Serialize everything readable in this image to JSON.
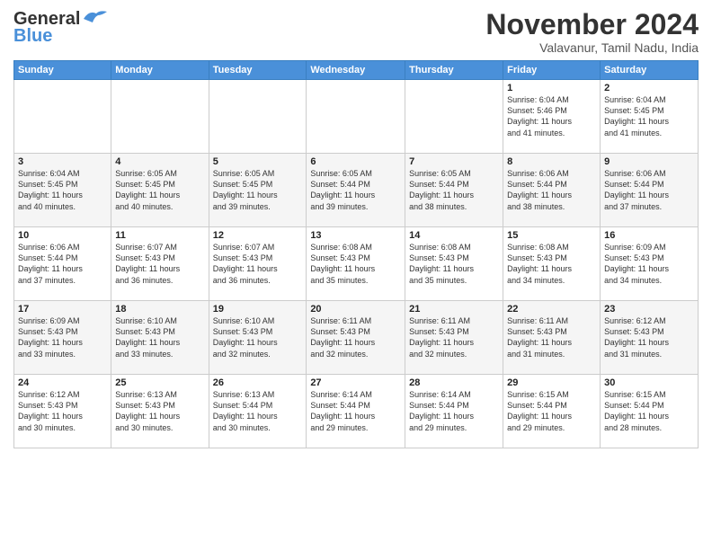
{
  "logo": {
    "general": "General",
    "blue": "Blue"
  },
  "header": {
    "month": "November 2024",
    "location": "Valavanur, Tamil Nadu, India"
  },
  "weekdays": [
    "Sunday",
    "Monday",
    "Tuesday",
    "Wednesday",
    "Thursday",
    "Friday",
    "Saturday"
  ],
  "weeks": [
    [
      {
        "day": "",
        "info": ""
      },
      {
        "day": "",
        "info": ""
      },
      {
        "day": "",
        "info": ""
      },
      {
        "day": "",
        "info": ""
      },
      {
        "day": "",
        "info": ""
      },
      {
        "day": "1",
        "info": "Sunrise: 6:04 AM\nSunset: 5:46 PM\nDaylight: 11 hours\nand 41 minutes."
      },
      {
        "day": "2",
        "info": "Sunrise: 6:04 AM\nSunset: 5:45 PM\nDaylight: 11 hours\nand 41 minutes."
      }
    ],
    [
      {
        "day": "3",
        "info": "Sunrise: 6:04 AM\nSunset: 5:45 PM\nDaylight: 11 hours\nand 40 minutes."
      },
      {
        "day": "4",
        "info": "Sunrise: 6:05 AM\nSunset: 5:45 PM\nDaylight: 11 hours\nand 40 minutes."
      },
      {
        "day": "5",
        "info": "Sunrise: 6:05 AM\nSunset: 5:45 PM\nDaylight: 11 hours\nand 39 minutes."
      },
      {
        "day": "6",
        "info": "Sunrise: 6:05 AM\nSunset: 5:44 PM\nDaylight: 11 hours\nand 39 minutes."
      },
      {
        "day": "7",
        "info": "Sunrise: 6:05 AM\nSunset: 5:44 PM\nDaylight: 11 hours\nand 38 minutes."
      },
      {
        "day": "8",
        "info": "Sunrise: 6:06 AM\nSunset: 5:44 PM\nDaylight: 11 hours\nand 38 minutes."
      },
      {
        "day": "9",
        "info": "Sunrise: 6:06 AM\nSunset: 5:44 PM\nDaylight: 11 hours\nand 37 minutes."
      }
    ],
    [
      {
        "day": "10",
        "info": "Sunrise: 6:06 AM\nSunset: 5:44 PM\nDaylight: 11 hours\nand 37 minutes."
      },
      {
        "day": "11",
        "info": "Sunrise: 6:07 AM\nSunset: 5:43 PM\nDaylight: 11 hours\nand 36 minutes."
      },
      {
        "day": "12",
        "info": "Sunrise: 6:07 AM\nSunset: 5:43 PM\nDaylight: 11 hours\nand 36 minutes."
      },
      {
        "day": "13",
        "info": "Sunrise: 6:08 AM\nSunset: 5:43 PM\nDaylight: 11 hours\nand 35 minutes."
      },
      {
        "day": "14",
        "info": "Sunrise: 6:08 AM\nSunset: 5:43 PM\nDaylight: 11 hours\nand 35 minutes."
      },
      {
        "day": "15",
        "info": "Sunrise: 6:08 AM\nSunset: 5:43 PM\nDaylight: 11 hours\nand 34 minutes."
      },
      {
        "day": "16",
        "info": "Sunrise: 6:09 AM\nSunset: 5:43 PM\nDaylight: 11 hours\nand 34 minutes."
      }
    ],
    [
      {
        "day": "17",
        "info": "Sunrise: 6:09 AM\nSunset: 5:43 PM\nDaylight: 11 hours\nand 33 minutes."
      },
      {
        "day": "18",
        "info": "Sunrise: 6:10 AM\nSunset: 5:43 PM\nDaylight: 11 hours\nand 33 minutes."
      },
      {
        "day": "19",
        "info": "Sunrise: 6:10 AM\nSunset: 5:43 PM\nDaylight: 11 hours\nand 32 minutes."
      },
      {
        "day": "20",
        "info": "Sunrise: 6:11 AM\nSunset: 5:43 PM\nDaylight: 11 hours\nand 32 minutes."
      },
      {
        "day": "21",
        "info": "Sunrise: 6:11 AM\nSunset: 5:43 PM\nDaylight: 11 hours\nand 32 minutes."
      },
      {
        "day": "22",
        "info": "Sunrise: 6:11 AM\nSunset: 5:43 PM\nDaylight: 11 hours\nand 31 minutes."
      },
      {
        "day": "23",
        "info": "Sunrise: 6:12 AM\nSunset: 5:43 PM\nDaylight: 11 hours\nand 31 minutes."
      }
    ],
    [
      {
        "day": "24",
        "info": "Sunrise: 6:12 AM\nSunset: 5:43 PM\nDaylight: 11 hours\nand 30 minutes."
      },
      {
        "day": "25",
        "info": "Sunrise: 6:13 AM\nSunset: 5:43 PM\nDaylight: 11 hours\nand 30 minutes."
      },
      {
        "day": "26",
        "info": "Sunrise: 6:13 AM\nSunset: 5:44 PM\nDaylight: 11 hours\nand 30 minutes."
      },
      {
        "day": "27",
        "info": "Sunrise: 6:14 AM\nSunset: 5:44 PM\nDaylight: 11 hours\nand 29 minutes."
      },
      {
        "day": "28",
        "info": "Sunrise: 6:14 AM\nSunset: 5:44 PM\nDaylight: 11 hours\nand 29 minutes."
      },
      {
        "day": "29",
        "info": "Sunrise: 6:15 AM\nSunset: 5:44 PM\nDaylight: 11 hours\nand 29 minutes."
      },
      {
        "day": "30",
        "info": "Sunrise: 6:15 AM\nSunset: 5:44 PM\nDaylight: 11 hours\nand 28 minutes."
      }
    ]
  ]
}
